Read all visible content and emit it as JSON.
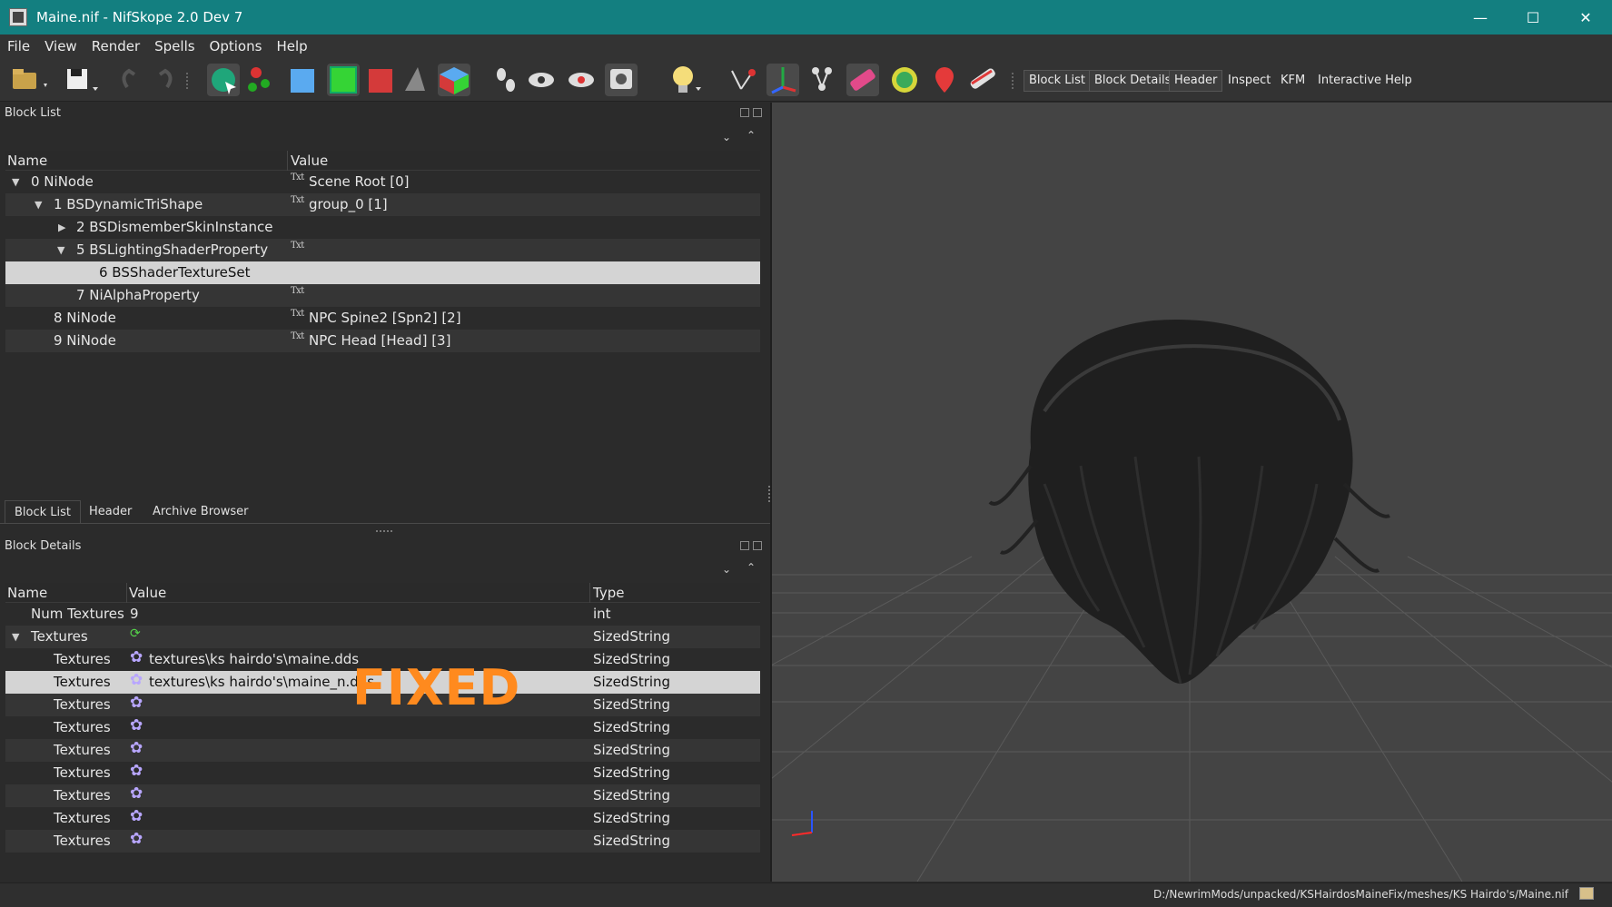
{
  "window": {
    "title": "Maine.nif - NifSkope 2.0 Dev 7",
    "minimize": "—",
    "maximize": "☐",
    "close": "✕"
  },
  "menu": [
    "File",
    "View",
    "Render",
    "Spells",
    "Options",
    "Help"
  ],
  "toolbar": {
    "text_buttons": [
      "Block List",
      "Block Details",
      "Header",
      "Inspect",
      "KFM",
      "Interactive Help"
    ]
  },
  "block_list": {
    "title": "Block List",
    "columns": [
      "Name",
      "Value"
    ],
    "rows": [
      {
        "name": "0 NiNode",
        "value": "Scene Root [0]",
        "expand": "▼",
        "txt": "Txt"
      },
      {
        "name": "1 BSDynamicTriShape",
        "value": "group_0 [1]",
        "expand": "▼",
        "txt": "Txt"
      },
      {
        "name": "2 BSDismemberSkinInstance",
        "value": "",
        "expand": "▶",
        "txt": ""
      },
      {
        "name": "5 BSLightingShaderProperty",
        "value": "",
        "expand": "▼",
        "txt": "Txt"
      },
      {
        "name": "6 BSShaderTextureSet",
        "value": "",
        "expand": "",
        "txt": ""
      },
      {
        "name": "7 NiAlphaProperty",
        "value": "",
        "expand": "",
        "txt": "Txt"
      },
      {
        "name": "8 NiNode",
        "value": "NPC Spine2 [Spn2] [2]",
        "expand": "",
        "txt": "Txt"
      },
      {
        "name": "9 NiNode",
        "value": "NPC Head [Head] [3]",
        "expand": "",
        "txt": "Txt"
      }
    ]
  },
  "tabs": [
    "Block List",
    "Header",
    "Archive Browser"
  ],
  "block_details": {
    "title": "Block Details",
    "columns": [
      "Name",
      "Value",
      "Type"
    ],
    "rows": [
      {
        "name": "Num Textures",
        "value": "9",
        "type": "int",
        "expand": ""
      },
      {
        "name": "Textures",
        "value": "",
        "type": "SizedString",
        "expand": "▼"
      },
      {
        "name": "Textures",
        "value": "textures\\ks hairdo's\\maine.dds",
        "type": "SizedString",
        "expand": ""
      },
      {
        "name": "Textures",
        "value": "textures\\ks hairdo's\\maine_n.dds",
        "type": "SizedString",
        "expand": ""
      },
      {
        "name": "Textures",
        "value": "",
        "type": "SizedString",
        "expand": ""
      },
      {
        "name": "Textures",
        "value": "",
        "type": "SizedString",
        "expand": ""
      },
      {
        "name": "Textures",
        "value": "",
        "type": "SizedString",
        "expand": ""
      },
      {
        "name": "Textures",
        "value": "",
        "type": "SizedString",
        "expand": ""
      },
      {
        "name": "Textures",
        "value": "",
        "type": "SizedString",
        "expand": ""
      },
      {
        "name": "Textures",
        "value": "",
        "type": "SizedString",
        "expand": ""
      },
      {
        "name": "Textures",
        "value": "",
        "type": "SizedString",
        "expand": ""
      }
    ]
  },
  "overlay_text": "FIXED",
  "status": {
    "path": "D:/NewrimMods/unpacked/KSHairdosMaineFix/meshes/KS Hairdo's/Maine.nif"
  }
}
